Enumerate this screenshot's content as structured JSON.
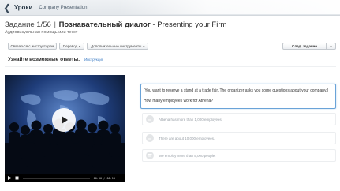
{
  "topbar": {
    "back_label": "Уроки",
    "breadcrumb": "Company Presentation"
  },
  "task": {
    "number": "Задание 1/56",
    "title_ru": "Познавательный диалог",
    "title_en": "Presenting your Firm",
    "subtitle": "Аудиовизуальная помощь или текст"
  },
  "toolbar": {
    "instructor_button": "Связаться с инструктором",
    "translate_button": "Перевод",
    "tools_button": "Дополнительные инструменты",
    "next_button": "След. задание"
  },
  "instruction": {
    "text": "Узнайте возможные ответы.",
    "link": "Инструкция"
  },
  "video": {
    "time": "00:00 / 00:10"
  },
  "question": {
    "text": "[You want to reserve a stand at a trade fair. The organizer asks you some questions about your company.] How many employees work for Athena?"
  },
  "answers": [
    {
      "text": "Athena has more than 1,000 employees."
    },
    {
      "text": "There are about 10,000 employees."
    },
    {
      "text": "We employ more than 5,000 people."
    }
  ],
  "colors": {
    "accent": "#3b7bc4",
    "question_border": "#6aa3d8",
    "video_bg": "#0a1224"
  },
  "icons": {
    "back": "chevron-left-icon",
    "play": "play-icon",
    "pause": "pause-icon",
    "stop": "stop-icon",
    "volume": "volume-icon",
    "answer": "speech-icon"
  }
}
